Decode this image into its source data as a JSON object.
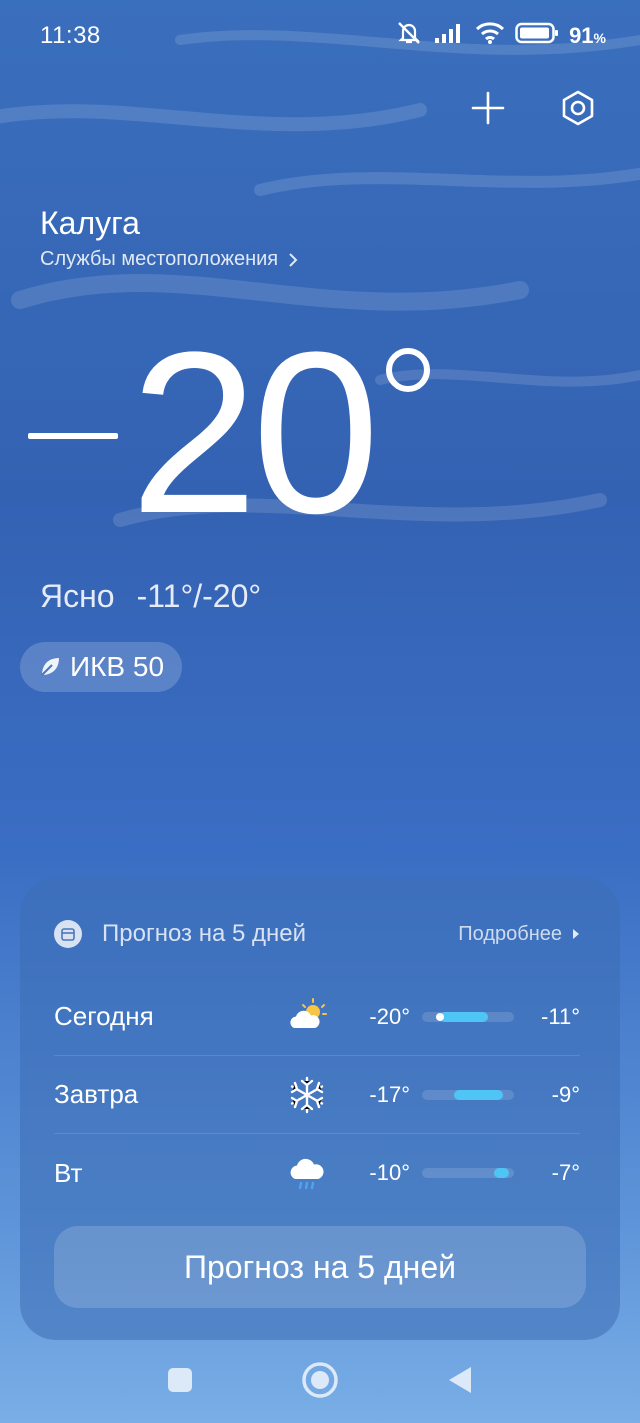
{
  "status_bar": {
    "time": "11:38",
    "battery_percent": "91",
    "battery_unit": "%",
    "icons": [
      "mute-icon",
      "signal-icon",
      "wifi-icon",
      "battery-icon"
    ]
  },
  "header": {
    "city": "Калуга",
    "location_services": "Службы местоположения"
  },
  "current": {
    "temperature": "20",
    "condition": "Ясно",
    "range": "-11°/-20°",
    "aqi_label": "ИКВ 50"
  },
  "forecast": {
    "title": "Прогноз на 5 дней",
    "more": "Подробнее",
    "days": [
      {
        "day": "Сегодня",
        "icon": "partly-cloudy-icon",
        "min": "-20°",
        "max": "-11°",
        "bar_from": 0.2,
        "bar_to": 0.72,
        "current_marker": 0.2
      },
      {
        "day": "Завтра",
        "icon": "snowflake-icon",
        "min": "-17°",
        "max": "-9°",
        "bar_from": 0.35,
        "bar_to": 0.88
      },
      {
        "day": "Вт",
        "icon": "rain-cloud-icon",
        "min": "-10°",
        "max": "-7°",
        "bar_from": 0.78,
        "bar_to": 0.95
      }
    ],
    "button": "Прогноз на 5 дней"
  },
  "colors": {
    "bar_fill": "#4fc5f5",
    "sun": "#f6c544",
    "rain": "#4fa4f0"
  }
}
